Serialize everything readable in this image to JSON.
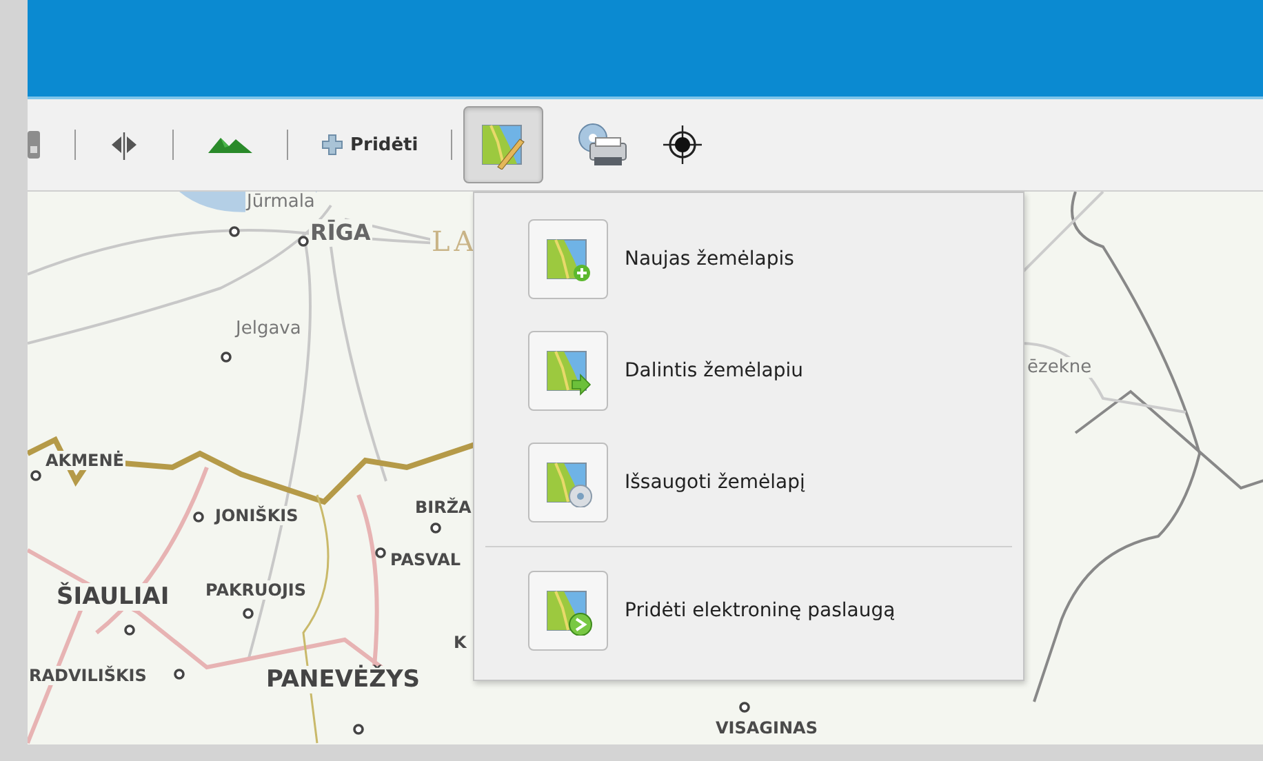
{
  "toolbar": {
    "add_button": {
      "label": "Pridėti"
    },
    "map_menu_button": {
      "expanded": true
    }
  },
  "menu": {
    "sections": [
      [
        {
          "kind": "new",
          "label": "Naujas žemėlapis"
        },
        {
          "kind": "share",
          "label": "Dalintis žemėlapiu"
        },
        {
          "kind": "save",
          "label": "Išsaugoti žemėlapį"
        }
      ],
      [
        {
          "kind": "service",
          "label": "Pridėti elektroninę paslaugą"
        }
      ]
    ]
  },
  "map": {
    "labels": [
      "Jūrmala",
      "RĪGA",
      "LA",
      "Jelgava",
      "AKMENĖ",
      "JONIŠKIS",
      "BIRŽA",
      "PASVAL",
      "ŠIAULIAI",
      "PAKRUOJIS",
      "K",
      "RADVILIŠKIS",
      "PANEVĖŽYS",
      "VISAGINAS",
      "ēzekne"
    ]
  }
}
